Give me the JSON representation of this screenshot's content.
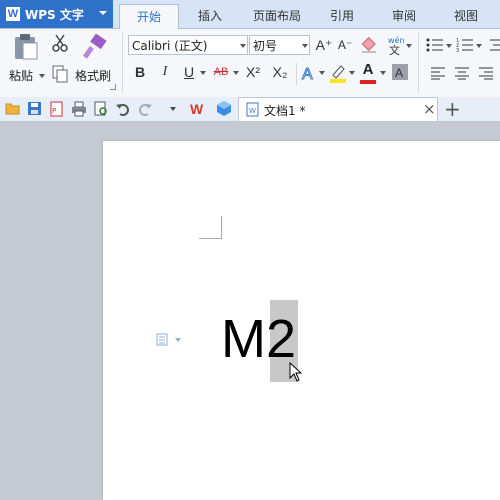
{
  "app": {
    "title": "WPS 文字",
    "logo_letter": "W"
  },
  "menu_tabs": [
    "开始",
    "插入",
    "页面布局",
    "引用",
    "审阅",
    "视图"
  ],
  "active_tab": "开始",
  "ribbon": {
    "paste_label": "粘贴",
    "format_painter_label": "格式刷",
    "font_name": "Calibri (正文)",
    "font_size": "初号",
    "bold": "B",
    "italic": "I",
    "underline": "U",
    "strike": "AB",
    "superscript": "X²",
    "subscript": "X₂",
    "font_color_letter": "A",
    "grow_font": "A⁺",
    "shrink_font": "A⁻"
  },
  "quickbar": {
    "doc_tab_label": "文档1 *",
    "close_symbol": "×",
    "new_tab_symbol": "+"
  },
  "document": {
    "text_main": "M",
    "text_selected": "2"
  },
  "colors": {
    "accent": "#2f72c9",
    "selection": "#c8c8c8",
    "font_color_bar": "#e02020",
    "highlight_bar": "#f5e61e"
  }
}
